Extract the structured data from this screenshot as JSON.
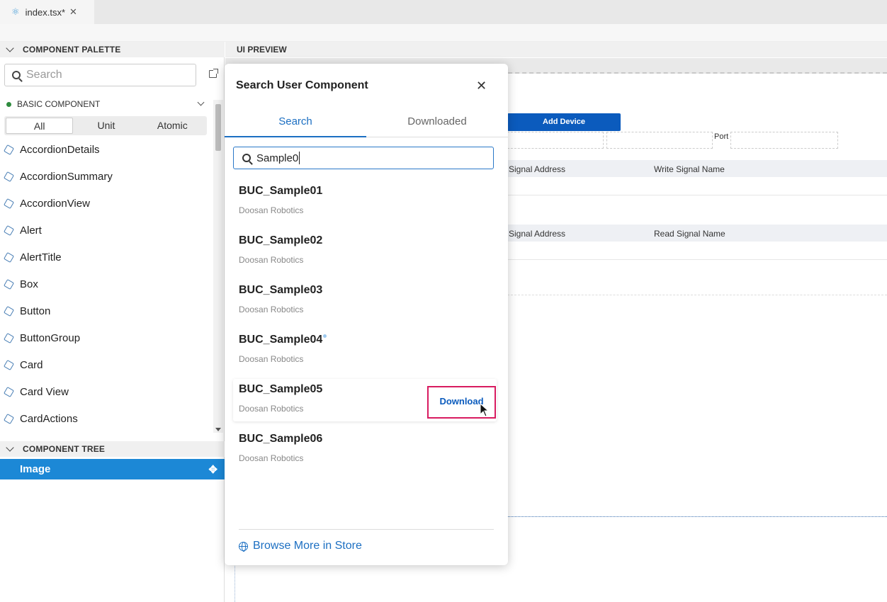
{
  "editor_tab": {
    "filename": "index.tsx*"
  },
  "palette": {
    "header": "COMPONENT PALETTE",
    "search_placeholder": "Search",
    "group_label": "BASIC COMPONENT",
    "filters": [
      "All",
      "Unit",
      "Atomic"
    ],
    "active_filter": "All",
    "items": [
      "AccordionDetails",
      "AccordionSummary",
      "AccordionView",
      "Alert",
      "AlertTitle",
      "Box",
      "Button",
      "ButtonGroup",
      "Card",
      "Card View",
      "CardActions"
    ]
  },
  "tree": {
    "header": "COMPONENT TREE",
    "selected_item": "Image"
  },
  "preview": {
    "header": "UI PREVIEW",
    "add_device_label": "Add Device",
    "port_label": "Port",
    "write_row": {
      "address": "Signal Address",
      "name": "Write Signal Name"
    },
    "read_row": {
      "address": "Signal Address",
      "name": "Read Signal Name"
    }
  },
  "modal": {
    "title": "Search User Component",
    "tabs": [
      "Search",
      "Downloaded"
    ],
    "active_tab": "Search",
    "search_value": "Sample0",
    "results": [
      {
        "name": "BUC_Sample01",
        "publisher": "Doosan Robotics"
      },
      {
        "name": "BUC_Sample02",
        "publisher": "Doosan Robotics"
      },
      {
        "name": "BUC_Sample03",
        "publisher": "Doosan Robotics"
      },
      {
        "name": "BUC_Sample04",
        "publisher": "Doosan Robotics"
      },
      {
        "name": "BUC_Sample05",
        "publisher": "Doosan Robotics"
      },
      {
        "name": "BUC_Sample06",
        "publisher": "Doosan Robotics"
      }
    ],
    "download_label": "Download",
    "footer_link": "Browse More in Store"
  },
  "colors": {
    "accent": "#1c6fc2",
    "selection": "#1c88d6",
    "highlight": "#d81b60",
    "button": "#0b5bbd"
  }
}
